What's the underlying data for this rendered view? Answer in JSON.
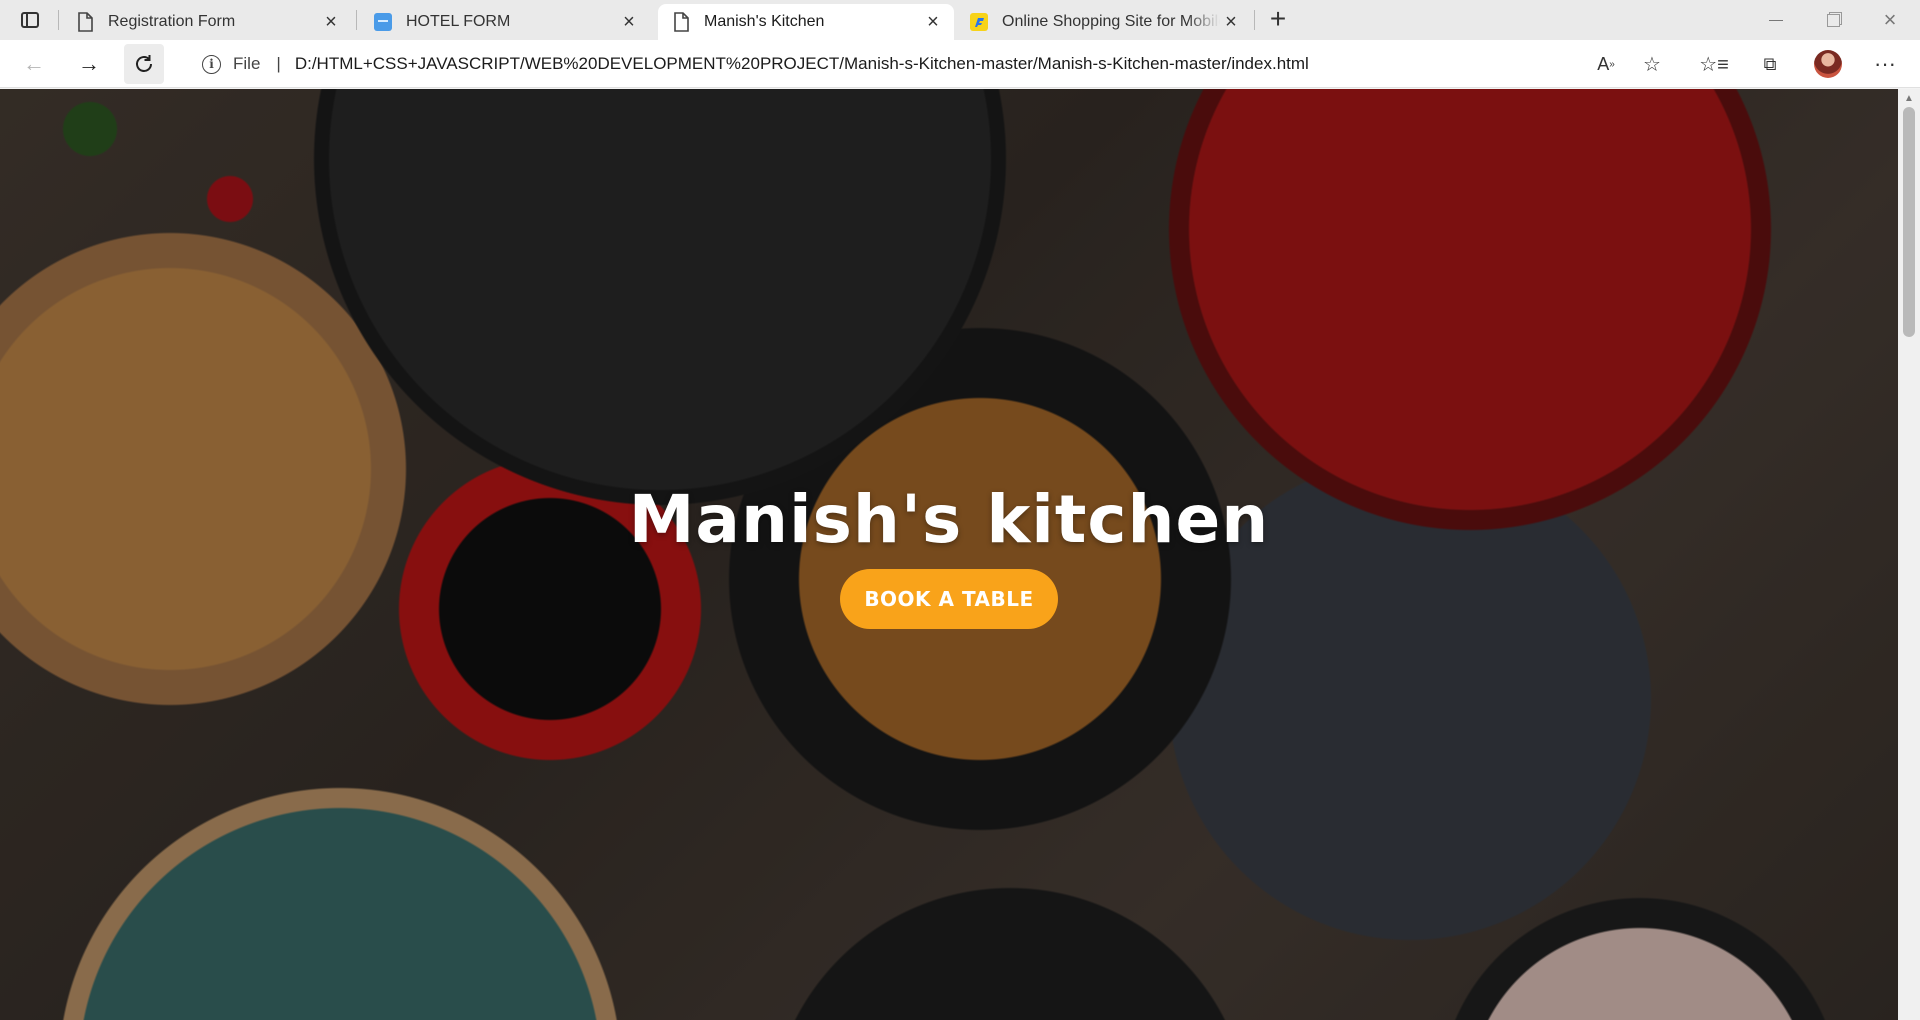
{
  "tabs": [
    {
      "title": "Registration Form",
      "favicon": "page-icon",
      "active": false
    },
    {
      "title": "HOTEL FORM",
      "favicon": "hotel-site-icon",
      "active": false
    },
    {
      "title": "Manish's Kitchen",
      "favicon": "page-icon",
      "active": true
    },
    {
      "title": "Online Shopping Site for Mobiles",
      "favicon": "flipkart-icon",
      "active": false
    }
  ],
  "address_bar": {
    "scheme_label": "File",
    "url": "D:/HTML+CSS+JAVASCRIPT/WEB%20DEVELOPMENT%20PROJECT/Manish-s-Kitchen-master/Manish-s-Kitchen-master/index.html"
  },
  "page": {
    "title": "Manish's kitchen",
    "cta_label": "BOOK A TABLE",
    "cta_color": "#f9a31a"
  },
  "colors": {
    "tabstrip": "#eaeaea",
    "active_tab": "#ffffff"
  }
}
